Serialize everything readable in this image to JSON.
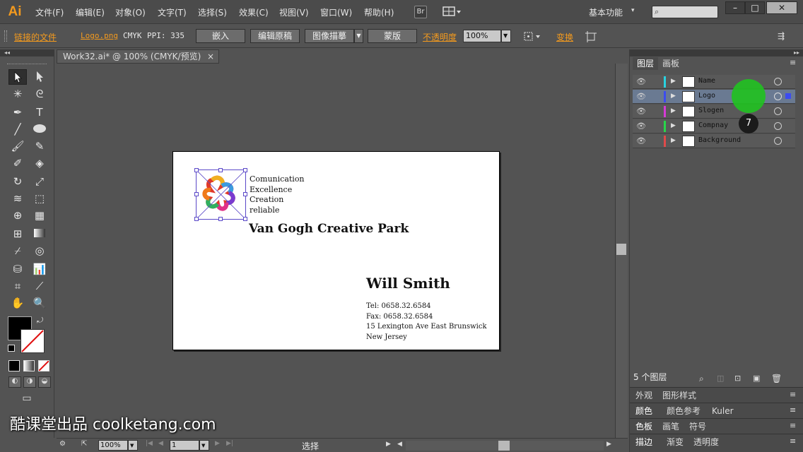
{
  "app": {
    "logo": "Ai"
  },
  "menu": [
    "文件(F)",
    "编辑(E)",
    "对象(O)",
    "文字(T)",
    "选择(S)",
    "效果(C)",
    "视图(V)",
    "窗口(W)",
    "帮助(H)"
  ],
  "menubar": {
    "bridge_label": "Br",
    "workspace": "基本功能",
    "window_buttons": [
      "–",
      "□",
      "✕"
    ]
  },
  "control": {
    "linked_file": "链接的文件",
    "file_name": "Logo.png",
    "color_mode": "CMYK",
    "ppi": "PPI: 335",
    "embed": "嵌入",
    "edit_original": "编辑原稿",
    "image_trace": "图像描摹",
    "mask": "蒙版",
    "opacity_label": "不透明度",
    "opacity_value": "100%",
    "transform": "变换"
  },
  "document": {
    "tab_title": "Work32.ai* @ 100% (CMYK/预览)",
    "close": "×"
  },
  "artboard": {
    "tagline": [
      "Comunication",
      "Excellence",
      "Creation",
      "reliable"
    ],
    "company": "Van Gogh Creative Park",
    "person": "Will Smith",
    "contact": [
      "Tel: 0658.32.6584",
      "Fax: 0658.32.6584",
      "15 Lexington Ave East Brunswick",
      "New Jersey"
    ]
  },
  "status": {
    "zoom": "100%",
    "page": "1",
    "tool": "选择"
  },
  "panels": {
    "layers_tab": "图层",
    "artboards_tab": "画板",
    "layers": [
      {
        "name": "Name",
        "color": "#29d2e0"
      },
      {
        "name": "Logo",
        "color": "#3c4cf0"
      },
      {
        "name": "Slogen",
        "color": "#d63ad6"
      },
      {
        "name": "Compnay",
        "color": "#28d64a"
      },
      {
        "name": "Background",
        "color": "#e04a4a"
      }
    ],
    "layer_count": "5 个图层",
    "badge": "7",
    "group1": [
      "外观",
      "图形样式"
    ],
    "group2": [
      "颜色",
      "颜色参考",
      "Kuler"
    ],
    "group3": [
      "色板",
      "画笔",
      "符号"
    ],
    "group4": [
      "描边",
      "渐变",
      "透明度"
    ]
  },
  "watermark": "酷课堂出品 coolketang.com"
}
